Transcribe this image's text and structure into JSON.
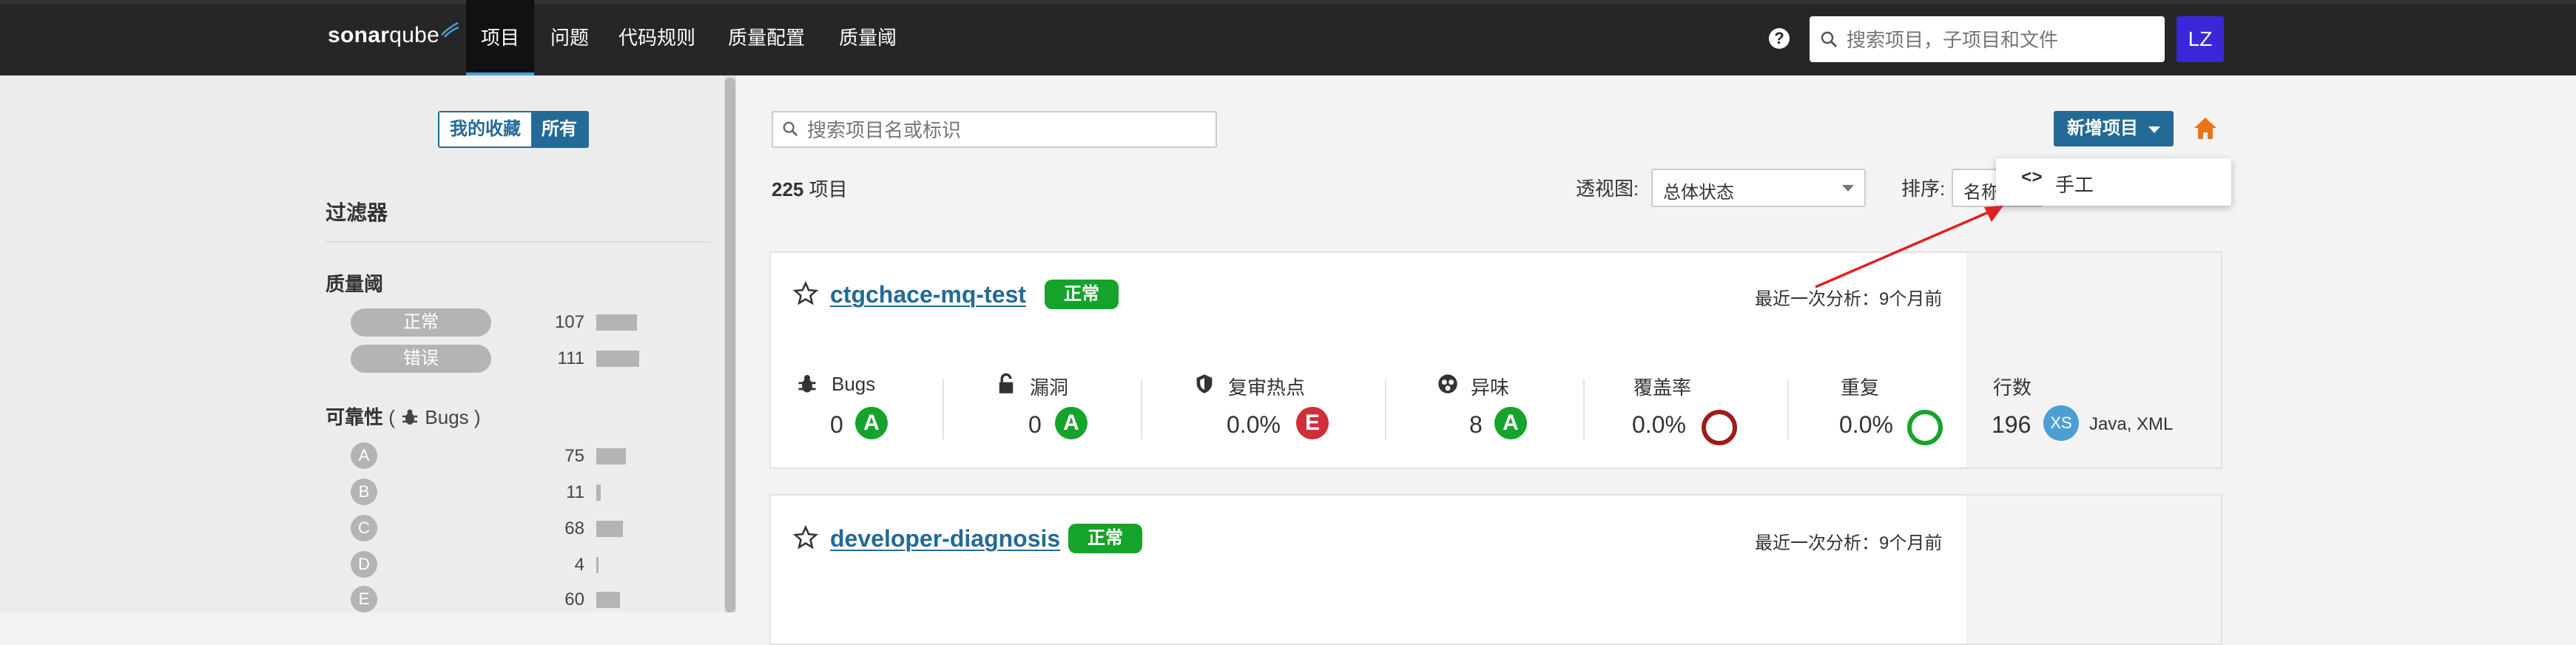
{
  "topnav": {
    "brand": {
      "part1": "sonar",
      "part2": "qube"
    },
    "items": [
      {
        "label": "项目",
        "active": true
      },
      {
        "label": "问题"
      },
      {
        "label": "代码规则"
      },
      {
        "label": "质量配置"
      },
      {
        "label": "质量阈"
      }
    ],
    "help": "?",
    "search_placeholder": "搜索项目，子项目和文件",
    "avatar": "LZ"
  },
  "sidebar": {
    "toggle": {
      "favorites": "我的收藏",
      "all": "所有"
    },
    "filters_title": "过滤器",
    "quality_gate": {
      "title": "质量阈",
      "options": [
        {
          "label": "正常",
          "count": "107",
          "fraction": 0.46
        },
        {
          "label": "错误",
          "count": "111",
          "fraction": 0.48
        }
      ]
    },
    "reliability": {
      "title": "可靠性",
      "paren_open": "(",
      "sub": "Bugs",
      "paren_close": ")",
      "options": [
        {
          "label": "A",
          "count": "75",
          "fraction": 0.33
        },
        {
          "label": "B",
          "count": "11",
          "fraction": 0.05
        },
        {
          "label": "C",
          "count": "68",
          "fraction": 0.3
        },
        {
          "label": "D",
          "count": "4",
          "fraction": 0.02
        },
        {
          "label": "E",
          "count": "60",
          "fraction": 0.27
        }
      ]
    }
  },
  "main": {
    "search_placeholder": "搜索项目名或标识",
    "total_count": "225",
    "total_suffix": " 项目",
    "perspective_label": "透视图:",
    "perspective_value": "总体状态",
    "sort_label": "排序:",
    "sort_value": "名称",
    "create_label": "新增项目",
    "dropdown_item": {
      "icon": "<>",
      "label": "手工"
    }
  },
  "projects": [
    {
      "name": "ctgchace-mq-test",
      "status": "正常",
      "last_analysis": "最近一次分析：9个月前",
      "metrics": {
        "bugs": {
          "label": "Bugs",
          "value": "0",
          "rating": "A"
        },
        "vulns": {
          "label": "漏洞",
          "value": "0",
          "rating": "A"
        },
        "hotspots": {
          "label": "复审热点",
          "value": "0.0%",
          "rating": "E"
        },
        "smells": {
          "label": "异味",
          "value": "8",
          "rating": "A"
        },
        "coverage": {
          "label": "覆盖率",
          "value": "0.0%"
        },
        "duplication": {
          "label": "重复",
          "value": "0.0%"
        },
        "lines": {
          "label": "行数",
          "value": "196",
          "size": "XS",
          "languages": "Java, XML"
        }
      }
    },
    {
      "name": "developer-diagnosis",
      "status": "正常",
      "last_analysis": "最近一次分析：9个月前"
    }
  ],
  "colors": {
    "topbar": "#262626",
    "link_blue": "#236a97",
    "ok_green": "#16a32b",
    "rating_a": "#16a32b",
    "rating_e": "#d02f3a",
    "coverage_ring": "#9f1c1c",
    "duplication_ring": "#16a32b",
    "annotation_arrow": "#e02020"
  },
  "icons": [
    "search-icon",
    "help-icon",
    "star-icon",
    "bug-icon",
    "lock-icon",
    "shield-icon",
    "smell-icon",
    "home-icon",
    "code-icon",
    "caret-down-icon"
  ]
}
